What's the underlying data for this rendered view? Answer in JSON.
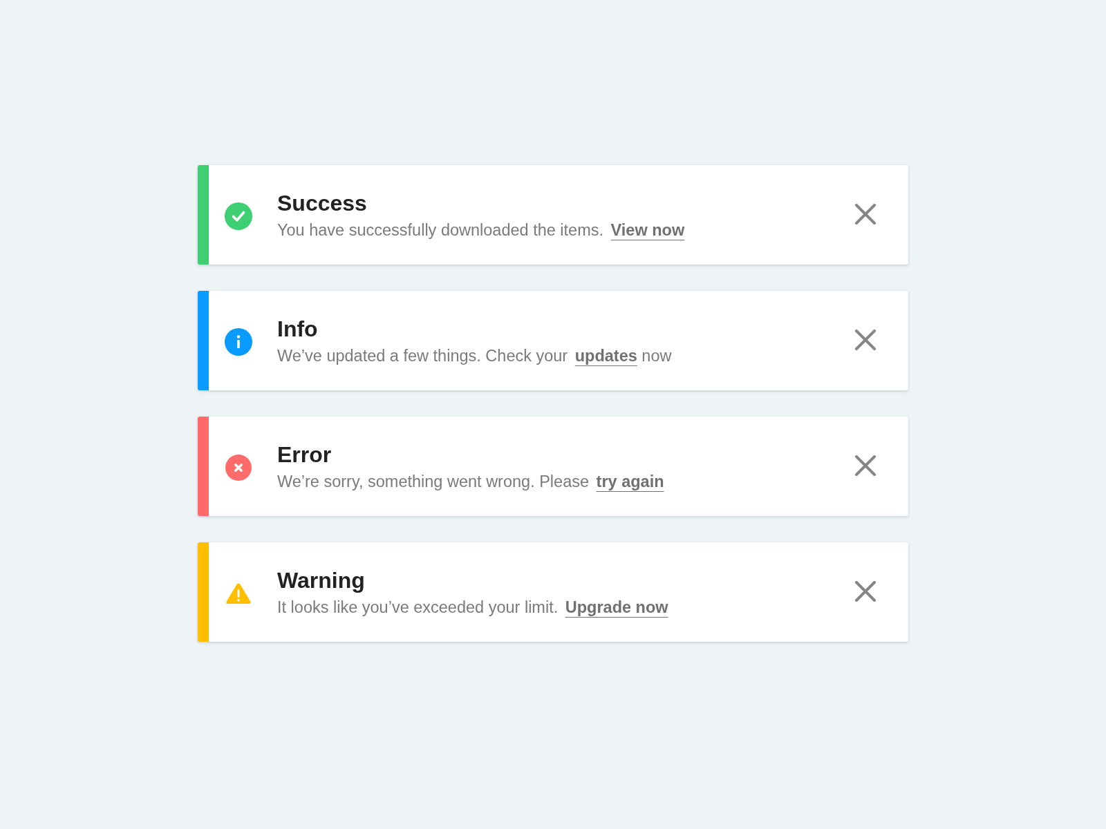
{
  "alerts": [
    {
      "kind": "success",
      "color": "#3ecf73",
      "title": "Success",
      "before": "You have successfully downloaded the items.",
      "link": "View now"
    },
    {
      "kind": "info",
      "color": "#0a9bff",
      "title": "Info",
      "before": "We’ve updated a few things. Check your",
      "link": "updates",
      "after": "now"
    },
    {
      "kind": "error",
      "color": "#ff6b6b",
      "title": "Error",
      "before": "We’re sorry, something went wrong. Please",
      "link": "try again"
    },
    {
      "kind": "warning",
      "color": "#ffbe00",
      "title": "Warning",
      "before": "It looks like you’ve exceeded your limit.",
      "link": "Upgrade now"
    }
  ]
}
